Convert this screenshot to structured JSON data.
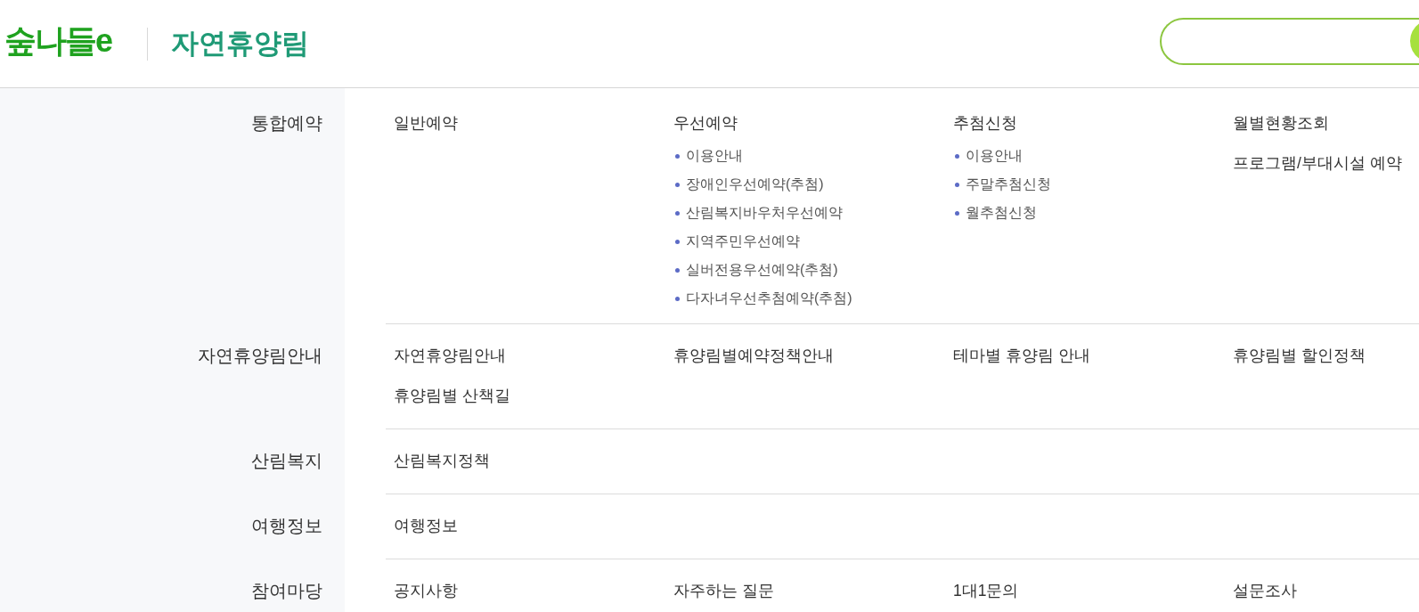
{
  "header": {
    "logo": "숲나들e",
    "title": "자연휴양림"
  },
  "menu": [
    {
      "label": "통합예약",
      "items": [
        {
          "label": "일반예약"
        },
        {
          "label": "우선예약",
          "children": [
            {
              "label": "이용안내"
            },
            {
              "label": "장애인우선예약(추첨)"
            },
            {
              "label": "산림복지바우처우선예약"
            },
            {
              "label": "지역주민우선예약"
            },
            {
              "label": "실버전용우선예약(추첨)"
            },
            {
              "label": "다자녀우선추첨예약(추첨)"
            }
          ]
        },
        {
          "label": "추첨신청",
          "children": [
            {
              "label": "이용안내"
            },
            {
              "label": "주말추첨신청"
            },
            {
              "label": "월추첨신청"
            }
          ]
        },
        {
          "label": "월별현황조회"
        },
        {
          "label": "프로그램/부대시설 예약"
        }
      ]
    },
    {
      "label": "자연휴양림안내",
      "items": [
        {
          "label": "자연휴양림안내"
        },
        {
          "label": "휴양림별예약정책안내"
        },
        {
          "label": "테마별 휴양림 안내"
        },
        {
          "label": "휴양림별 할인정책"
        },
        {
          "label": "휴양림별 산책길"
        }
      ]
    },
    {
      "label": "산림복지",
      "items": [
        {
          "label": "산림복지정책"
        }
      ]
    },
    {
      "label": "여행정보",
      "items": [
        {
          "label": "여행정보"
        }
      ]
    },
    {
      "label": "참여마당",
      "items": [
        {
          "label": "공지사항"
        },
        {
          "label": "자주하는 질문"
        },
        {
          "label": "1대1문의"
        },
        {
          "label": "설문조사"
        }
      ]
    }
  ]
}
